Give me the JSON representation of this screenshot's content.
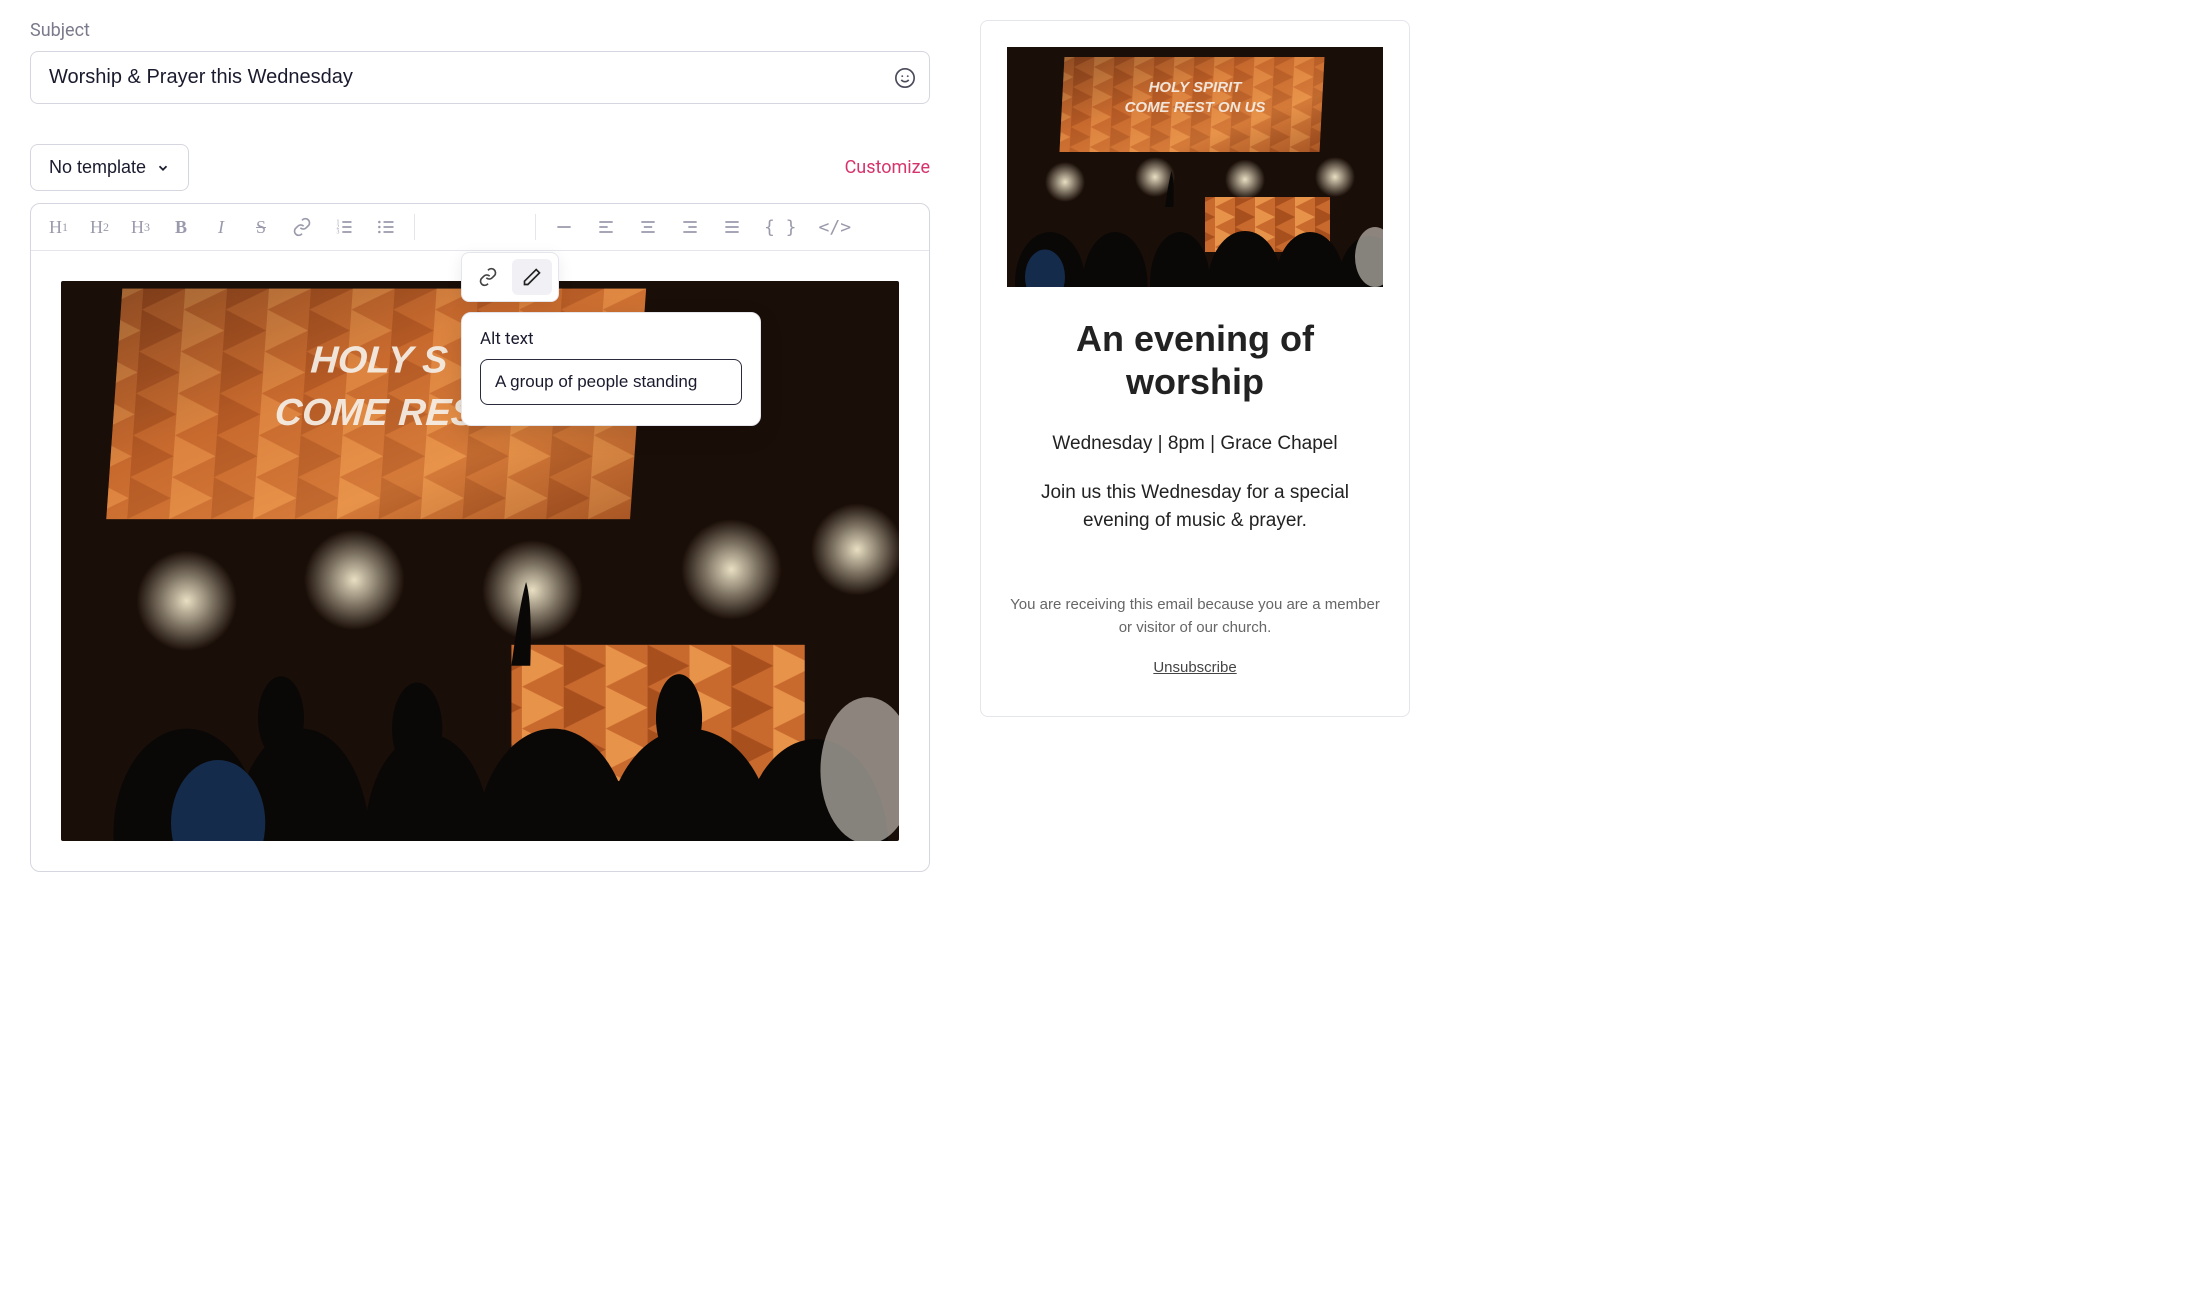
{
  "subject": {
    "label": "Subject",
    "value": "Worship & Prayer this Wednesday"
  },
  "template": {
    "button_label": "No template",
    "customize_label": "Customize"
  },
  "image_toolbar": {
    "alt_label": "Alt text",
    "alt_value": "A group of people standing"
  },
  "hero": {
    "screen_line1": "HOLY SPIRIT",
    "screen_line2": "COME REST ON US",
    "editor_screen_line1": "HOLY S",
    "editor_screen_line2": "COME RES"
  },
  "preview": {
    "title": "An evening of worship",
    "subtitle": "Wednesday | 8pm | Grace Chapel",
    "body": "Join us this Wednesday for a special evening of music & prayer.",
    "footer": "You are receiving this email because you are a member or visitor of our church.",
    "unsubscribe": "Unsubscribe"
  }
}
